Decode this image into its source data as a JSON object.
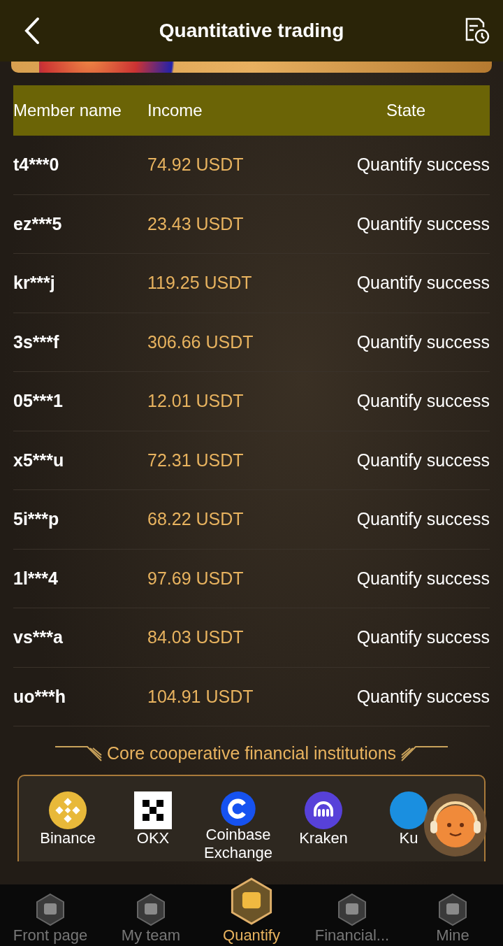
{
  "header": {
    "title": "Quantitative trading"
  },
  "table": {
    "columns": [
      "Member name",
      "Income",
      "State"
    ],
    "rows": [
      {
        "member": "t4***0",
        "income": "74.92 USDT",
        "state": "Quantify success"
      },
      {
        "member": "ez***5",
        "income": "23.43 USDT",
        "state": "Quantify success"
      },
      {
        "member": "kr***j",
        "income": "119.25 USDT",
        "state": "Quantify success"
      },
      {
        "member": "3s***f",
        "income": "306.66 USDT",
        "state": "Quantify success"
      },
      {
        "member": "05***1",
        "income": "12.01 USDT",
        "state": "Quantify success"
      },
      {
        "member": "x5***u",
        "income": "72.31 USDT",
        "state": "Quantify success"
      },
      {
        "member": "5i***p",
        "income": "68.22 USDT",
        "state": "Quantify success"
      },
      {
        "member": "1l***4",
        "income": "97.69 USDT",
        "state": "Quantify success"
      },
      {
        "member": "vs***a",
        "income": "84.03 USDT",
        "state": "Quantify success"
      },
      {
        "member": "uo***h",
        "income": "104.91 USDT",
        "state": "Quantify success"
      }
    ]
  },
  "partners": {
    "title": "Core cooperative financial institutions",
    "items": [
      {
        "name": "Binance",
        "kind": "binance"
      },
      {
        "name": "OKX",
        "kind": "okx"
      },
      {
        "name": "Coinbase Exchange",
        "kind": "coinbase"
      },
      {
        "name": "Kraken",
        "kind": "kraken"
      },
      {
        "name": "Ku",
        "kind": "kucoin"
      }
    ]
  },
  "nav": [
    {
      "label": "Front page",
      "selected": false
    },
    {
      "label": "My team",
      "selected": false
    },
    {
      "label": "Quantify",
      "selected": true
    },
    {
      "label": "Financial...",
      "selected": false
    },
    {
      "label": "Mine",
      "selected": false
    }
  ]
}
